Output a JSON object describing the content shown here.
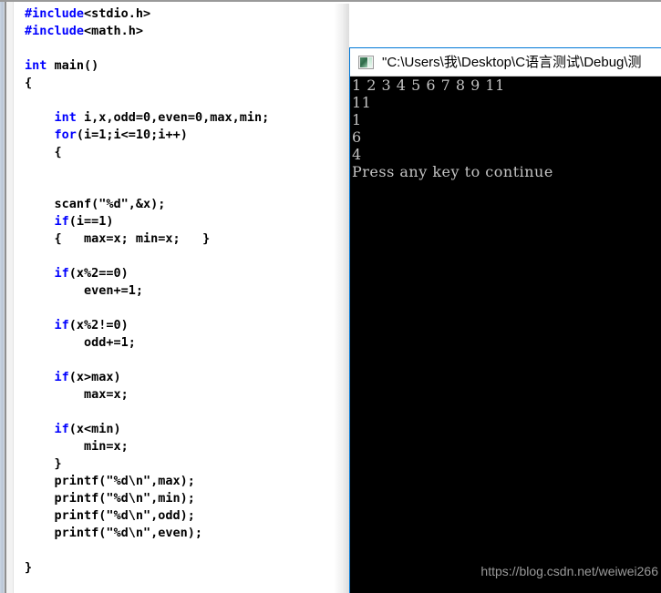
{
  "editor": {
    "name": "code-editor",
    "language": "C",
    "colors": {
      "keyword": "#0000ff",
      "preprocessor": "#0000ff",
      "text": "#000000",
      "background": "#ffffff"
    },
    "lines": [
      [
        {
          "t": "#include",
          "c": "pp"
        },
        {
          "t": "<stdio.h>",
          "c": ""
        }
      ],
      [
        {
          "t": "#include",
          "c": "pp"
        },
        {
          "t": "<math.h>",
          "c": ""
        }
      ],
      [],
      [
        {
          "t": "int",
          "c": "kw"
        },
        {
          "t": " main()",
          "c": ""
        }
      ],
      [
        {
          "t": "{",
          "c": ""
        }
      ],
      [],
      [
        {
          "t": "    ",
          "c": ""
        },
        {
          "t": "int",
          "c": "kw"
        },
        {
          "t": " i,x,odd=0,even=0,max,min;",
          "c": ""
        }
      ],
      [
        {
          "t": "    ",
          "c": ""
        },
        {
          "t": "for",
          "c": "kw"
        },
        {
          "t": "(i=1;i<=10;i++)",
          "c": ""
        }
      ],
      [
        {
          "t": "    {",
          "c": ""
        }
      ],
      [],
      [],
      [
        {
          "t": "    scanf(\"%d\",&x);",
          "c": ""
        }
      ],
      [
        {
          "t": "    ",
          "c": ""
        },
        {
          "t": "if",
          "c": "kw"
        },
        {
          "t": "(i==1)",
          "c": ""
        }
      ],
      [
        {
          "t": "    {   max=x; min=x;   }",
          "c": ""
        }
      ],
      [],
      [
        {
          "t": "    ",
          "c": ""
        },
        {
          "t": "if",
          "c": "kw"
        },
        {
          "t": "(x%2==0)",
          "c": ""
        }
      ],
      [
        {
          "t": "        even+=1;",
          "c": ""
        }
      ],
      [],
      [
        {
          "t": "    ",
          "c": ""
        },
        {
          "t": "if",
          "c": "kw"
        },
        {
          "t": "(x%2!=0)",
          "c": ""
        }
      ],
      [
        {
          "t": "        odd+=1;",
          "c": ""
        }
      ],
      [],
      [
        {
          "t": "    ",
          "c": ""
        },
        {
          "t": "if",
          "c": "kw"
        },
        {
          "t": "(x>max)",
          "c": ""
        }
      ],
      [
        {
          "t": "        max=x;",
          "c": ""
        }
      ],
      [],
      [
        {
          "t": "    ",
          "c": ""
        },
        {
          "t": "if",
          "c": "kw"
        },
        {
          "t": "(x<min)",
          "c": ""
        }
      ],
      [
        {
          "t": "        min=x;",
          "c": ""
        }
      ],
      [
        {
          "t": "    }",
          "c": ""
        }
      ],
      [
        {
          "t": "    printf(\"%d\\n\",max);",
          "c": ""
        }
      ],
      [
        {
          "t": "    printf(\"%d\\n\",min);",
          "c": ""
        }
      ],
      [
        {
          "t": "    printf(\"%d\\n\",odd);",
          "c": ""
        }
      ],
      [
        {
          "t": "    printf(\"%d\\n\",even);",
          "c": ""
        }
      ],
      [],
      [
        {
          "t": "}",
          "c": ""
        }
      ]
    ]
  },
  "console": {
    "icon": "console-window-icon",
    "title": "\"C:\\Users\\我\\Desktop\\C语言测试\\Debug\\测",
    "title_full_truncated": true,
    "background": "#000000",
    "foreground": "#c3c3c3",
    "output_lines": [
      "1 2 3 4 5 6 7 8 9 11",
      "11",
      "1",
      "6",
      "4",
      "Press any key to continue"
    ],
    "caret_visible": true
  },
  "watermark": {
    "text": "https://blog.csdn.net/weiwei266",
    "color": "#9a9a9a"
  }
}
